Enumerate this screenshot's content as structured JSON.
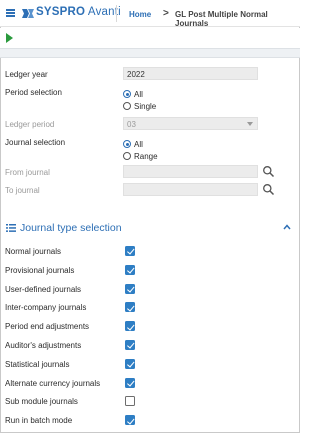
{
  "header": {
    "brand_name": "SYSPRO",
    "brand_product": " Avanti",
    "home": "Home",
    "separator": ">",
    "page_title": "GL Post Multiple Normal Journals"
  },
  "colors": {
    "accent": "#2d6fb5",
    "run_green": "#2a9a3d",
    "checkbox_on": "#2e7ec4",
    "field_bg": "#ececec"
  },
  "toolbar": {
    "run_icon": "play-icon"
  },
  "form": {
    "ledger_year": {
      "label": "Ledger year",
      "value": "2022"
    },
    "period_selection": {
      "label": "Period selection",
      "options": [
        "All",
        "Single"
      ],
      "selected": "All"
    },
    "ledger_period": {
      "label": "Ledger period",
      "value": "03"
    },
    "journal_selection": {
      "label": "Journal selection",
      "options": [
        "All",
        "Range"
      ],
      "selected": "All"
    },
    "from_journal": {
      "label": "From journal",
      "value": ""
    },
    "to_journal": {
      "label": "To journal",
      "value": ""
    }
  },
  "journal_types": {
    "title": "Journal type selection",
    "items": [
      {
        "label": "Normal journals",
        "checked": true
      },
      {
        "label": "Provisional journals",
        "checked": true
      },
      {
        "label": "User-defined journals",
        "checked": true
      },
      {
        "label": "Inter-company journals",
        "checked": true
      },
      {
        "label": "Period end adjustments",
        "checked": true
      },
      {
        "label": "Auditor's adjustments",
        "checked": true
      },
      {
        "label": "Statistical journals",
        "checked": true
      },
      {
        "label": "Alternate currency journals",
        "checked": true
      },
      {
        "label": "Sub module journals",
        "checked": false
      },
      {
        "label": "Run in batch mode",
        "checked": true
      }
    ]
  }
}
